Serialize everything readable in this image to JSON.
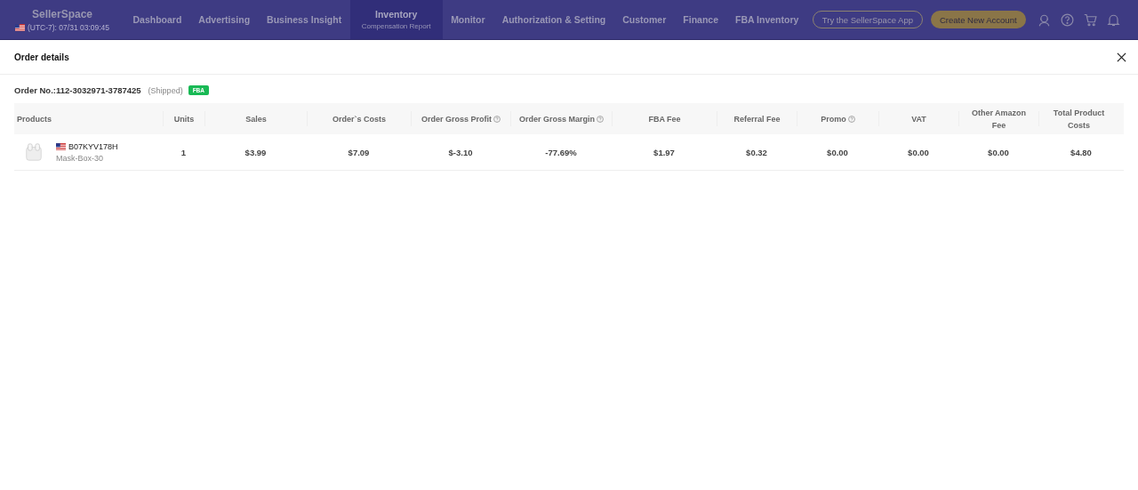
{
  "top_bar": {
    "logo": "SellerSpace",
    "clock": "(UTC-7): 07/31 03:09:45",
    "nav": [
      {
        "label": "Dashboard",
        "selected": false
      },
      {
        "label": "Advertising",
        "selected": false
      },
      {
        "label": "Business Insight",
        "selected": false
      },
      {
        "label": "Inventory",
        "sub": "Compensation Report",
        "selected": true
      },
      {
        "label": "Monitor",
        "selected": false
      },
      {
        "label": "Authorization & Setting",
        "selected": false
      },
      {
        "label": "Customer",
        "selected": false
      },
      {
        "label": "Finance",
        "selected": false
      },
      {
        "label": "FBA Inventory",
        "selected": false
      }
    ],
    "buttons": [
      {
        "label": "Try the SellerSpace App",
        "kind": "outline"
      },
      {
        "label": "Create New Account",
        "kind": "filled"
      }
    ]
  },
  "dialog": {
    "title": "Order details",
    "order": {
      "label": "Order No.:112-3032971-3787425",
      "status": "(Shipped)",
      "badge": "FBA"
    },
    "table": {
      "columns": [
        {
          "label": "Products"
        },
        {
          "label": "Units"
        },
        {
          "label": "Sales"
        },
        {
          "label": "Order`s Costs"
        },
        {
          "label": "Order Gross Profit",
          "info": true
        },
        {
          "label": "Order Gross Margin",
          "info": true
        },
        {
          "label": "FBA Fee"
        },
        {
          "label": "Referral Fee"
        },
        {
          "label": "Promo",
          "info": true
        },
        {
          "label": "VAT"
        },
        {
          "label": "Other Amazon Fee"
        },
        {
          "label": "Total Product Costs"
        }
      ],
      "rows": [
        {
          "cells": [
            {
              "kind": "product",
              "asin": "B07KYV178H",
              "sku": "Mask-Box-30"
            },
            {
              "kind": "text",
              "text": "1"
            },
            {
              "kind": "text",
              "text": "$3.99"
            },
            {
              "kind": "text",
              "text": "$7.09"
            },
            {
              "kind": "text",
              "text": "$-3.10"
            },
            {
              "kind": "text",
              "text": "-77.69%"
            },
            {
              "kind": "text",
              "text": "$1.97"
            },
            {
              "kind": "text",
              "text": "$0.32"
            },
            {
              "kind": "text",
              "text": "$0.00"
            },
            {
              "kind": "text",
              "text": "$0.00"
            },
            {
              "kind": "text",
              "text": "$0.00"
            },
            {
              "kind": "text",
              "text": "$4.80"
            }
          ]
        }
      ]
    }
  }
}
